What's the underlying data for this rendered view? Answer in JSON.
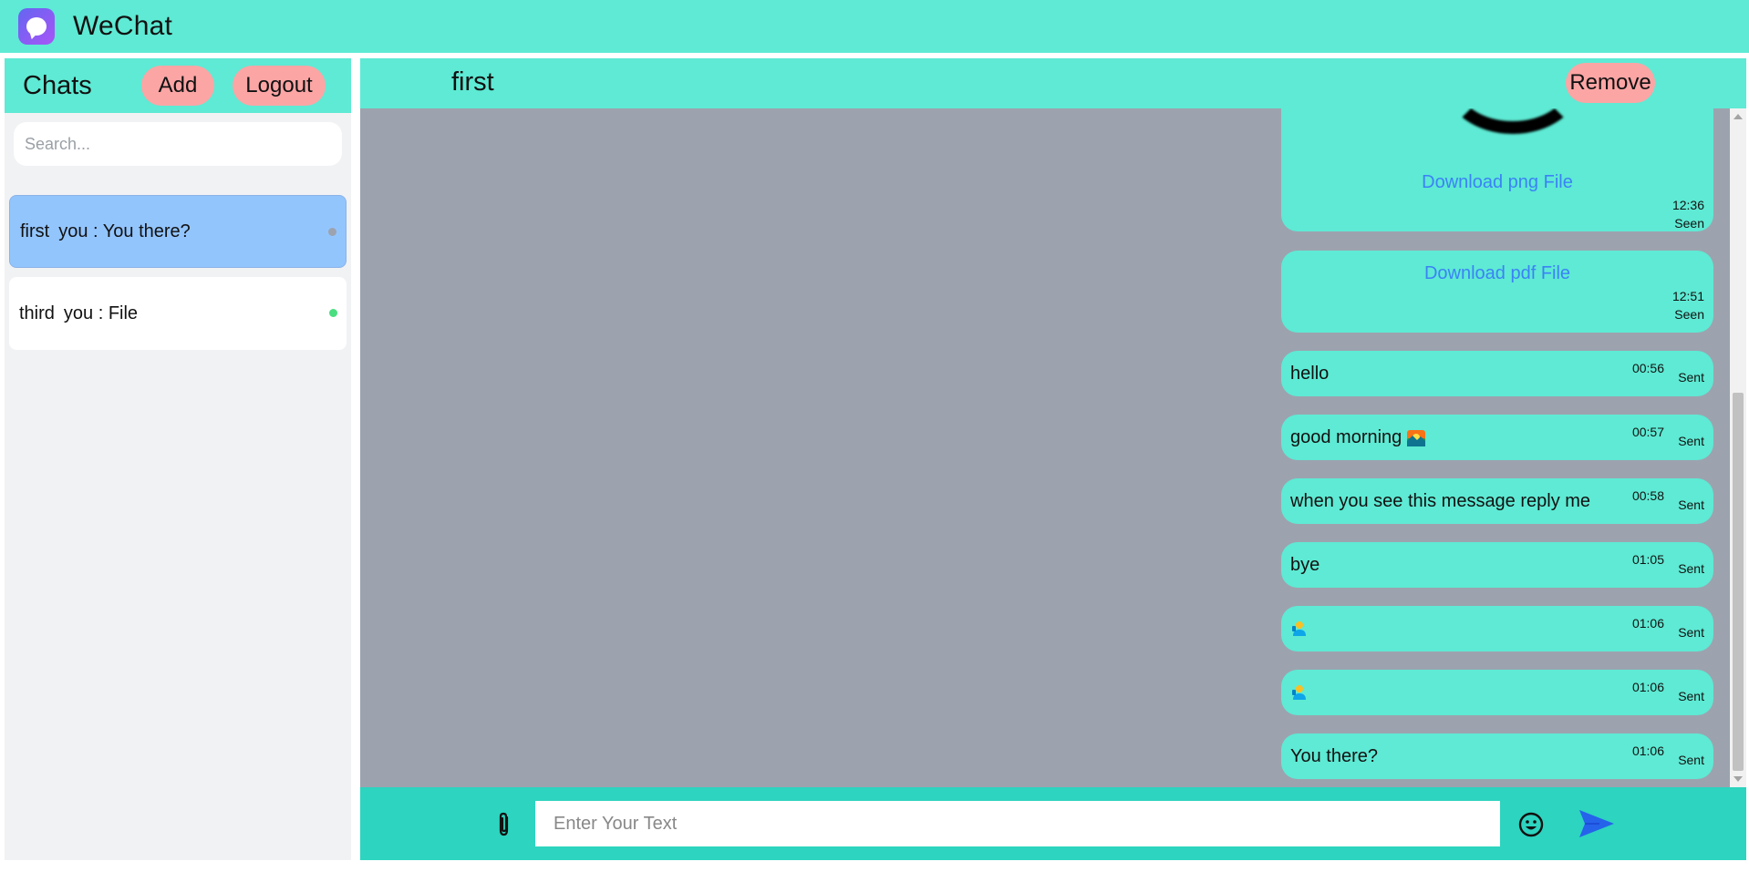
{
  "app": {
    "title": "WeChat"
  },
  "sidebar": {
    "title": "Chats",
    "add_label": "Add",
    "logout_label": "Logout",
    "search_placeholder": "Search...",
    "chats": [
      {
        "name": "first",
        "preview": "you : You there?",
        "active": true,
        "status_color": "#9ca3af"
      },
      {
        "name": "third",
        "preview": "you : File",
        "active": false,
        "status_color": "#4ade80"
      }
    ]
  },
  "chat": {
    "contact_name": "first",
    "remove_label": "Remove",
    "messages": [
      {
        "type": "file",
        "link": "Download png File",
        "time": "12:36",
        "status": "Seen"
      },
      {
        "type": "file",
        "link": "Download pdf File",
        "time": "12:51",
        "status": "Seen"
      },
      {
        "type": "text",
        "text": "hello",
        "time": "00:56",
        "status": "Sent"
      },
      {
        "type": "text",
        "text": "good morning",
        "emoji": "sunrise-emoji",
        "time": "00:57",
        "status": "Sent"
      },
      {
        "type": "text",
        "text": "when you see this message reply me",
        "time": "00:58",
        "status": "Sent"
      },
      {
        "type": "text",
        "text": "bye",
        "time": "01:05",
        "status": "Sent"
      },
      {
        "type": "emoji",
        "emoji": "person-emoji",
        "time": "01:06",
        "status": "Sent"
      },
      {
        "type": "emoji",
        "emoji": "person-emoji",
        "time": "01:06",
        "status": "Sent"
      },
      {
        "type": "text",
        "text": "You there?",
        "time": "01:06",
        "status": "Sent"
      }
    ]
  },
  "composer": {
    "placeholder": "Enter Your Text",
    "attach_icon": "paperclip-icon",
    "emoji_icon": "smiley-icon",
    "send_icon": "send-arrow-icon"
  },
  "colors": {
    "accent": "#5eead4",
    "composer": "#2dd4bf",
    "pill": "#fca5a5",
    "active_chat": "#93c5fd",
    "link": "#3b82f6",
    "chat_bg": "#9ca3af"
  }
}
